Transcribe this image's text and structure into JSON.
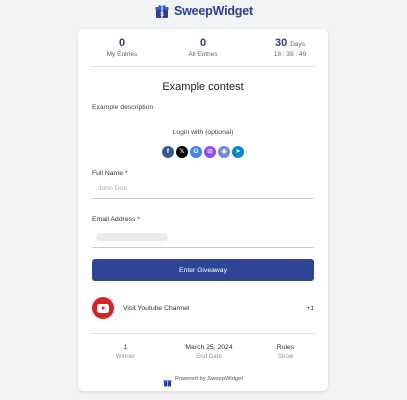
{
  "brand": {
    "name": "SweepWidget",
    "color": "#2d3e9a"
  },
  "stats": {
    "my_entries": {
      "value": "0",
      "label": "My Entries"
    },
    "all_entries": {
      "value": "0",
      "label": "All Entries"
    },
    "countdown": {
      "value": "30",
      "unit": "Days",
      "time": "18 : 39 : 49"
    }
  },
  "contest": {
    "title": "Example contest",
    "description": "Example description"
  },
  "login": {
    "label": "Login with (optional)",
    "providers": [
      {
        "name": "facebook-icon",
        "glyph": "f",
        "color": "#3b5998"
      },
      {
        "name": "x-icon",
        "glyph": "𝕏",
        "color": "#000000"
      },
      {
        "name": "google-icon",
        "glyph": "G",
        "color": "#4285f4"
      },
      {
        "name": "twitch-icon",
        "glyph": "⊡",
        "color": "#9146ff"
      },
      {
        "name": "discord-icon",
        "glyph": "◉",
        "color": "#7289da"
      },
      {
        "name": "telegram-icon",
        "glyph": "➤",
        "color": "#0088cc"
      }
    ]
  },
  "form": {
    "full_name": {
      "label": "Full Name *",
      "placeholder": "John Doe",
      "value": ""
    },
    "email": {
      "label": "Email Address *",
      "value": ""
    },
    "submit_label": "Enter Giveaway",
    "submit_color": "#2e4596"
  },
  "actions": [
    {
      "label": "Visit Youtube Channel",
      "points": "+1",
      "icon": "youtube-icon",
      "color": "#d92323"
    }
  ],
  "footer": {
    "winners": {
      "value": "1",
      "label": "Winner"
    },
    "end_date": {
      "value": "March 25, 2024",
      "label": "End Date"
    },
    "rules": {
      "value": "Rules",
      "label": "Show"
    },
    "powered_by": "Powered by SweepWidget"
  }
}
